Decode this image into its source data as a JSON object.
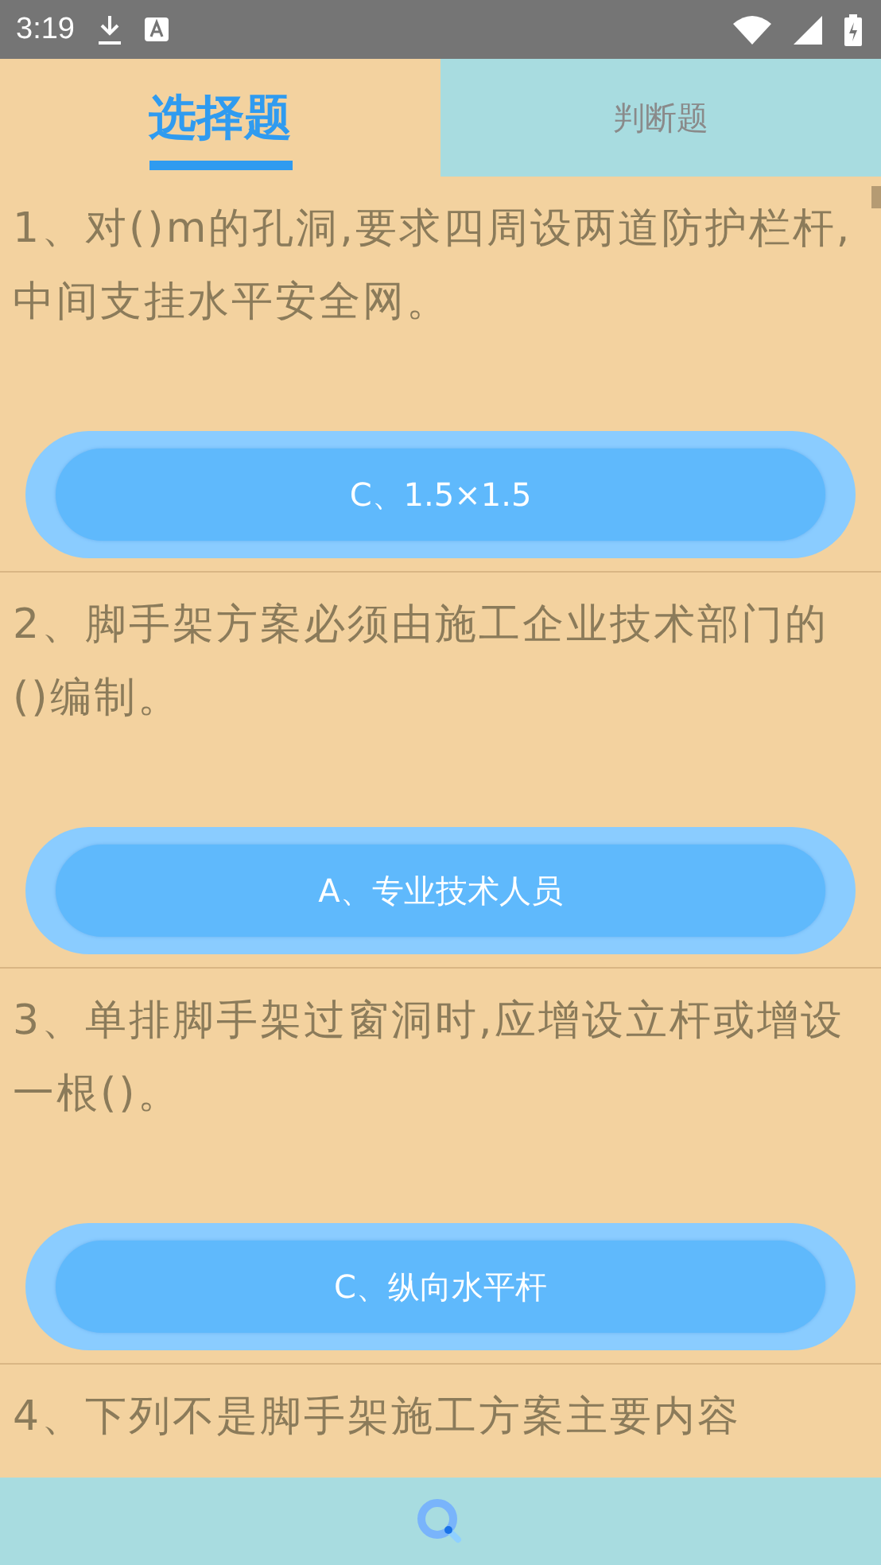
{
  "status_bar": {
    "time": "3:19"
  },
  "tabs": [
    {
      "label": "选择题",
      "selected": true
    },
    {
      "label": "判断题",
      "selected": false
    }
  ],
  "questions": [
    {
      "text": "1、对()m的孔洞,要求四周设两道防护栏杆,中间支挂水平安全网。",
      "answer": "C、1.5×1.5"
    },
    {
      "text": "2、脚手架方案必须由施工企业技术部门的()编制。",
      "answer": "A、专业技术人员"
    },
    {
      "text": "3、单排脚手架过窗洞时,应增设立杆或增设一根()。",
      "answer": "C、纵向水平杆"
    },
    {
      "text": "4、下列不是脚手架施工方案主要内容"
    }
  ]
}
